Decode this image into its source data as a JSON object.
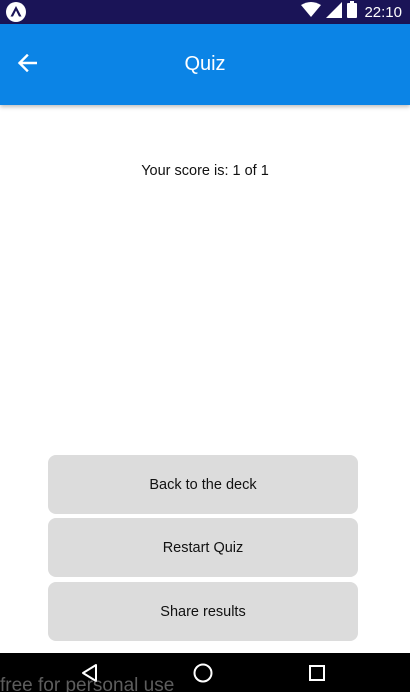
{
  "status_bar": {
    "time": "22:10",
    "icons": [
      "expo-icon",
      "wifi-icon",
      "signal-icon",
      "battery-icon"
    ]
  },
  "app_bar": {
    "title": "Quiz",
    "back_icon": "arrow-left-icon"
  },
  "result": {
    "score_text": "Your score is: 1 of 1"
  },
  "actions": {
    "back_to_deck": "Back to the deck",
    "restart_quiz": "Restart Quiz",
    "share_results": "Share results"
  },
  "nav_bar": {
    "icons": [
      "nav-back-icon",
      "nav-home-icon",
      "nav-recents-icon"
    ]
  },
  "watermark": "free for personal use",
  "colors": {
    "status_bar": "#1a1457",
    "app_bar": "#0b84e6",
    "button_bg": "#dcdcdc",
    "nav_bar": "#000000"
  }
}
